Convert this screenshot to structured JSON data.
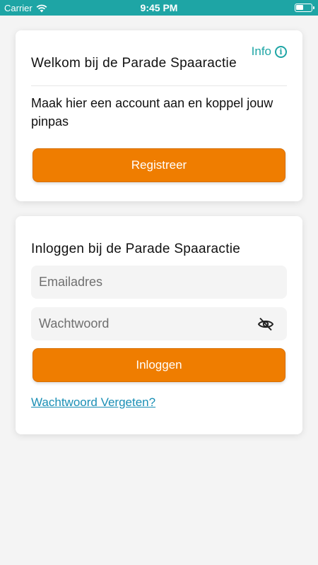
{
  "status_bar": {
    "carrier": "Carrier",
    "time": "9:45 PM"
  },
  "welcome_card": {
    "info_label": "Info",
    "title": "Welkom bij de Parade Spaaractie",
    "description": "Maak hier een account aan en koppel jouw pinpas",
    "register_label": "Registreer"
  },
  "login_card": {
    "title": "Inloggen bij de Parade Spaaractie",
    "email_placeholder": "Emailadres",
    "password_placeholder": "Wachtwoord",
    "login_label": "Inloggen",
    "forgot_label": "Wachtwoord Vergeten?"
  },
  "colors": {
    "accent": "#1ea5a5",
    "button": "#ef7d00",
    "link": "#1a8fb5",
    "background": "#f4f4f4"
  }
}
